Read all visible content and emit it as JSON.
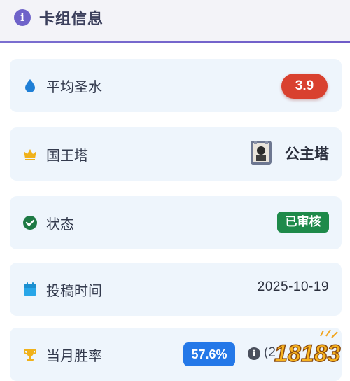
{
  "header": {
    "title": "卡组信息",
    "icon": "info-icon"
  },
  "rows": {
    "avg_elixir": {
      "icon": "water-drop-icon",
      "label": "平均圣水",
      "value": "3.9"
    },
    "king_tower": {
      "icon": "crown-icon",
      "label": "国王塔",
      "value": "公主塔"
    },
    "status": {
      "icon": "check-circle-icon",
      "label": "状态",
      "value": "已审核"
    },
    "submit_time": {
      "icon": "calendar-icon",
      "label": "投稿时间",
      "value": "2025-10-19"
    },
    "monthly_winrate": {
      "icon": "trophy-icon",
      "label": "当月胜率",
      "value": "57.6%",
      "extra": "(2"
    }
  },
  "watermark": {
    "text": "18183"
  },
  "colors": {
    "accent": "#6e62c9",
    "card_bg": "#eef5fc",
    "elixir_pill": "#d9412f",
    "approved": "#1e8a4a",
    "winrate_pill": "#2478e8"
  }
}
